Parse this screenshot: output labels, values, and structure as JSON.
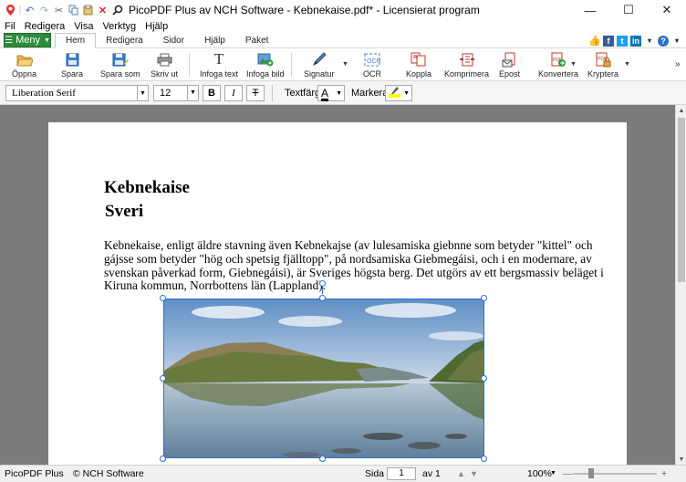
{
  "window": {
    "title": "PicoPDF Plus av NCH Software - Kebnekaise.pdf* - Licensierat program",
    "minimize": "—",
    "maximize": "☐",
    "close": "✕"
  },
  "menubar": [
    "Fil",
    "Redigera",
    "Visa",
    "Verktyg",
    "Hjälp"
  ],
  "ribbon": {
    "menu_button": "Meny",
    "tabs": [
      "Hem",
      "Redigera",
      "Sidor",
      "Hjälp",
      "Paket"
    ],
    "active_tab": "Hem"
  },
  "toolbar": {
    "open": "Öppna",
    "save": "Spara",
    "save_as": "Spara som",
    "print": "Skriv ut",
    "insert_text": "Infoga text",
    "insert_image": "Infoga bild",
    "signature": "Signatur",
    "ocr": "OCR",
    "link": "Koppla",
    "compress": "Komprimera",
    "email": "Epost",
    "convert": "Konvertera",
    "encrypt": "Kryptera"
  },
  "format": {
    "font": "Liberation Serif",
    "size": "12",
    "bold": "B",
    "italic": "I",
    "strike": "T",
    "text_color_label": "Textfärg:",
    "highlight_label": "Markera:",
    "text_color": "#000000",
    "highlight_color": "#ffff00"
  },
  "document": {
    "title": "Kebnekaise",
    "subtitle": "Sveri",
    "body": "Kebnekaise, enligt äldre stavning även Kebnekajse (av lulesamiska giebnne som betyder \"kittel\" och gájsse som betyder \"hög och spetsig fjälltopp\", på nordsamiska Giebmegáisi, och i en modernare, av svenskan påverkad form, Giebnegáisi), är Sveriges högsta berg. Det utgörs av ett bergsmassiv beläget i Kiruna kommun, Norrbottens län (Lappland)."
  },
  "status": {
    "app": "PicoPDF Plus",
    "copyright": "© NCH Software",
    "page_label": "Sida",
    "page_value": "1",
    "page_total": "av 1",
    "zoom": "100%",
    "zoom_minus": "—",
    "zoom_plus": "+"
  },
  "colors": {
    "menu_green": "#2e8b3a",
    "workspace": "#7b7b7b",
    "selection": "#2e6fd6"
  }
}
